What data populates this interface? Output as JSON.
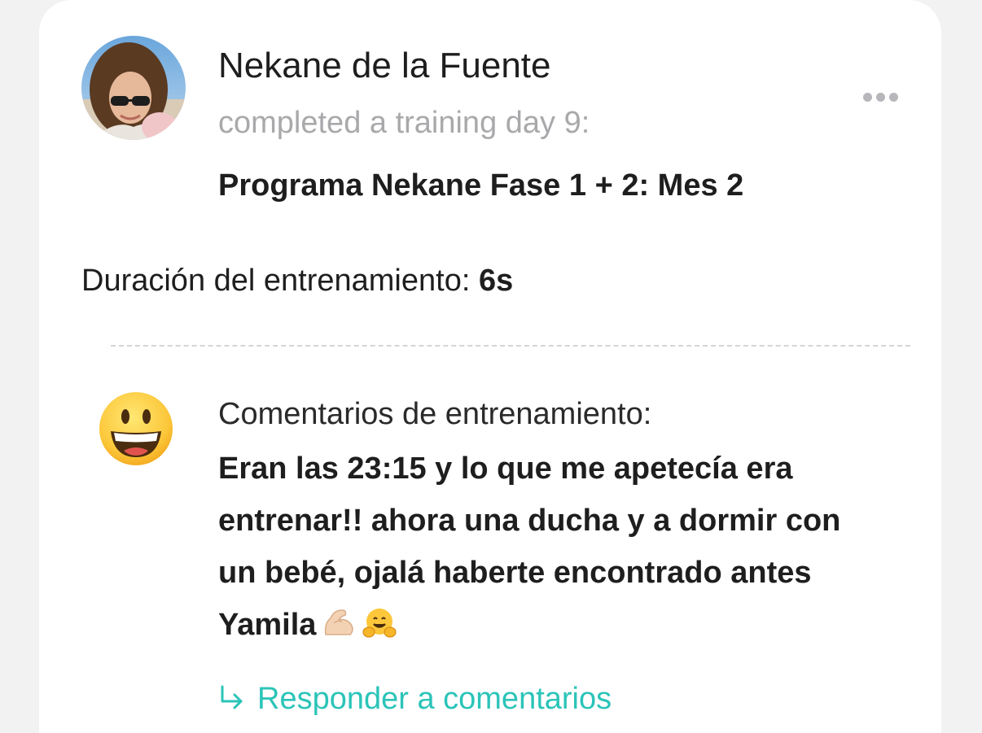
{
  "post": {
    "user_name": "Nekane de la Fuente",
    "activity_text": "completed a training day 9:",
    "program_name": "Programa Nekane Fase 1 + 2: Mes 2",
    "more_icon": "more-horizontal-icon"
  },
  "duration": {
    "label": "Duración del entrenamiento:",
    "value": "6s"
  },
  "comment": {
    "emoji_icon": "grinning-face-emoji",
    "label": "Comentarios de entrenamiento:",
    "body_line_1": "Eran las 23:15 y lo que me apetecía era",
    "body_line_2": "entrenar!! ahora una ducha y a dormir con",
    "body_line_3": "un bebé, ojalá haberte encontrado antes",
    "body_line_4": "Yamila",
    "emojis": [
      "flexed-biceps-emoji",
      "hugging-face-emoji"
    ]
  },
  "reply": {
    "icon": "reply-arrow-icon",
    "label": "Responder a comentarios",
    "color": "#2bc4b8"
  }
}
